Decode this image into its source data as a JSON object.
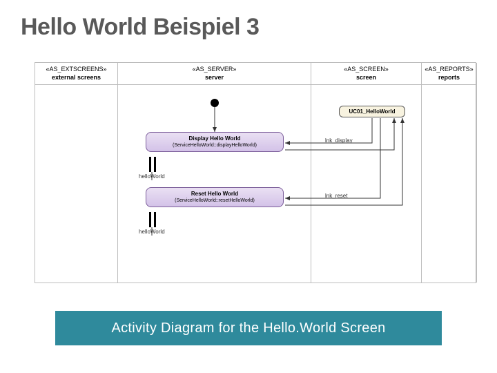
{
  "title": "Hello World Beispiel 3",
  "caption": "Activity Diagram for the Hello.World Screen",
  "lanes": [
    {
      "stereotype": "«AS_EXTSCREENS»",
      "name": "external screens"
    },
    {
      "stereotype": "«AS_SERVER»",
      "name": "server"
    },
    {
      "stereotype": "«AS_SCREEN»",
      "name": "screen"
    },
    {
      "stereotype": "«AS_REPORTS»",
      "name": "reports"
    }
  ],
  "usecase": {
    "label": "UC01_HelloWorld"
  },
  "activities": {
    "display": {
      "title": "Display Hello World",
      "sub": "(ServiceHelloWorld::displayHelloWorld)"
    },
    "reset": {
      "title": "Reset Hello World",
      "sub": "(ServiceHelloWorld::resetHelloWorld)"
    }
  },
  "labels": {
    "lnk_display": "lnk_display",
    "lnk_reset": "lnk_reset",
    "hello1": "helloWorld",
    "hello2": "helloWorld"
  }
}
